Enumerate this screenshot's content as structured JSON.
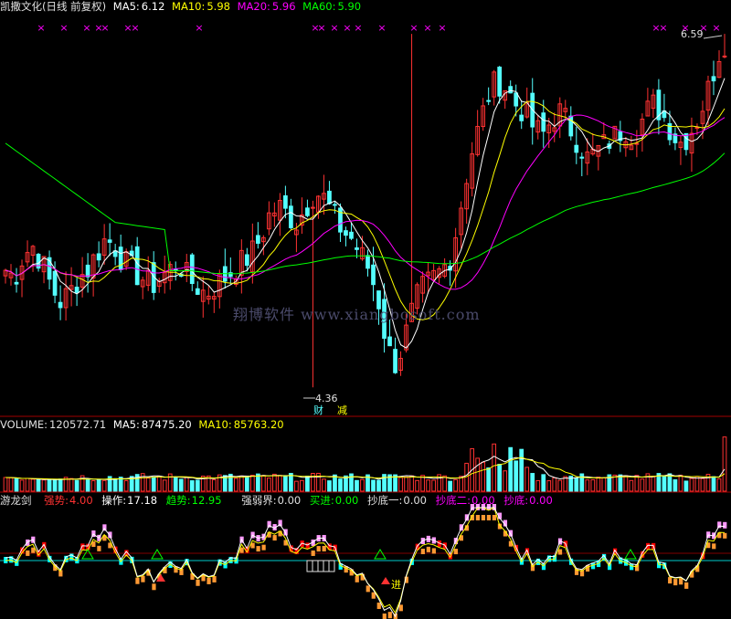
{
  "header": {
    "stock": "凯撒文化(日线 前复权)",
    "ma5_label": "MA5:",
    "ma5_value": "6.12",
    "ma10_label": "MA10:",
    "ma10_value": "5.98",
    "ma20_label": "MA20:",
    "ma20_value": "5.96",
    "ma60_label": "MA60:",
    "ma60_value": "5.90"
  },
  "volume_header": {
    "label": "VOLUME:",
    "value": "120572.71",
    "ma5_label": "MA5:",
    "ma5_value": "87475.20",
    "ma10_label": "MA10:",
    "ma10_value": "85763.20"
  },
  "indicator_header": {
    "name": "游龙剑",
    "items": [
      {
        "label": "强势:",
        "value": "4.00"
      },
      {
        "label": "操作:",
        "value": "17.18"
      },
      {
        "label": "趋势:",
        "value": "12.95"
      },
      {
        "label": "强弱界:",
        "value": "0.00"
      },
      {
        "label": "买进:",
        "value": "0.00"
      },
      {
        "label": "抄底一:",
        "value": "0.00"
      },
      {
        "label": "抄底二:",
        "value": "0.00"
      },
      {
        "label": "抄底:",
        "value": "0.00"
      }
    ]
  },
  "annotations": {
    "high_label": "6.59",
    "low_label": "4.36",
    "signal_cai": "财",
    "signal_jian": "减",
    "signal_jin": "进"
  },
  "watermark": "翔博软件 www.xiangbosoft.com",
  "colors": {
    "up": "#ff3232",
    "down": "#54ffff",
    "ma5": "#ffffff",
    "ma10": "#ffff00",
    "ma20": "#ff00ff",
    "ma60": "#00ff00",
    "pink": "#ff99ff",
    "orange": "#ff9933",
    "cyan": "#00ffff",
    "red_block": "#ff0000",
    "divider": "#a00000"
  },
  "chart_data": {
    "type": "candlestick",
    "ylim": [
      4.2,
      6.7
    ],
    "high": 6.59,
    "low": 4.36,
    "ma_periods": [
      5,
      10,
      20,
      60
    ],
    "series_close_est": [
      5.1,
      5.05,
      5.2,
      5.25,
      5.15,
      5.0,
      4.9,
      4.95,
      5.05,
      5.1,
      5.2,
      5.3,
      5.25,
      5.15,
      5.1,
      5.05,
      5.0,
      5.05,
      5.1,
      5.15,
      5.05,
      5.0,
      4.95,
      5.0,
      5.05,
      5.1,
      5.15,
      5.2,
      5.3,
      5.45,
      5.5,
      5.45,
      5.4,
      5.5,
      5.6,
      5.55,
      5.45,
      5.35,
      5.3,
      5.2,
      5.1,
      4.9,
      4.6,
      4.5,
      4.7,
      4.9,
      5.0,
      5.05,
      5.1,
      5.2,
      5.5,
      5.8,
      6.0,
      6.2,
      6.3,
      6.25,
      6.15,
      6.1,
      6.0,
      5.95,
      6.05,
      6.1,
      6.0,
      5.9,
      5.8,
      5.85,
      5.9,
      5.95,
      6.0,
      5.95,
      6.05,
      6.15,
      6.1,
      6.0,
      5.9,
      5.95,
      6.05,
      6.2,
      6.4,
      6.59
    ],
    "volume_ylim": [
      0,
      130000
    ],
    "volume_last": 120572.71
  }
}
